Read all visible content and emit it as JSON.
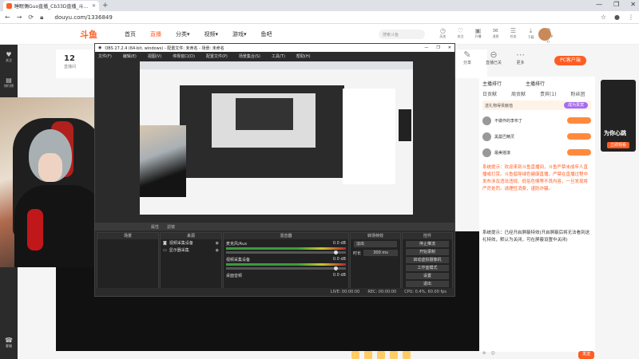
{
  "browser": {
    "tab_title": "睡眠偶Guo直播_Cb33D直播_斗...",
    "url": "douyu.com/1336849",
    "window_controls": [
      "—",
      "❐",
      "✕"
    ]
  },
  "header": {
    "logo": "斗鱼",
    "nav": [
      "首页",
      "直播",
      "分类▾",
      "视频▾",
      "游戏▾",
      "鱼吧"
    ],
    "active_nav": "直播",
    "search_placeholder": "搜索斗鱼",
    "icons": [
      {
        "label": "历史",
        "icon": "history-icon"
      },
      {
        "label": "关注",
        "icon": "follow-icon"
      },
      {
        "label": "开播",
        "icon": "live-icon"
      },
      {
        "label": "消息",
        "icon": "message-icon"
      },
      {
        "label": "任务",
        "icon": "task-icon"
      },
      {
        "label": "下载",
        "icon": "download-icon"
      },
      {
        "label": "会员中心",
        "icon": "vip-icon"
      }
    ]
  },
  "sidebar": {
    "items": [
      {
        "label": "关注",
        "icon": "heart-icon"
      },
      {
        "label": "排行榜",
        "icon": "rank-icon"
      },
      {
        "label": "客服",
        "icon": "service-icon"
      }
    ]
  },
  "room": {
    "number": "12",
    "subtext": "直播间",
    "pc_button": "PC客户端",
    "side_buttons": [
      {
        "label": "分享",
        "icon": "share-icon"
      },
      {
        "label": "直播已关",
        "icon": "closed-icon"
      },
      {
        "label": "更多",
        "icon": "more-icon"
      }
    ]
  },
  "rank": {
    "header_left": "主播排行",
    "header_right": "主播排行",
    "tabs": [
      "日贡献",
      "周贡献",
      "贵宾(1)",
      "粉丝团"
    ],
    "bar_text": "送礼物得贡献值",
    "bar_button": "成为贵宾",
    "rows": [
      {
        "name": "不做作的李布丁"
      },
      {
        "name": "黑曼巴精灵"
      },
      {
        "name": "最美摇滚"
      }
    ]
  },
  "chat": {
    "system": "系统提示：欢迎来到斗鱼直播间，斗鱼严禁未成年人直播或打赏。斗鱼倡导绿色健康直播，严禁在直播过程中发布涉及违法违规、低俗色情等不良内容，一旦发现将严厉处罚。请理性消费，谨防诈骗。",
    "notice": "系统提示：已经开启屏蔽特效(开启屏蔽后将无法看到送礼特效，默认为关闭，可在屏蔽设置中关闭)",
    "send_label": "发送"
  },
  "ad": {
    "text": "为你心跳",
    "button": "立即观看"
  },
  "obs": {
    "title": "OBS 27.2.4 (64-bit, windows) - 配置文件: 未命名 - 场景: 未命名",
    "menu": [
      "文件(F)",
      "编辑(E)",
      "视图(V)",
      "停靠窗口(D)",
      "配置文件(P)",
      "场景集合(S)",
      "工具(T)",
      "帮助(H)"
    ],
    "toolbar": [
      "属性",
      "滤镜"
    ],
    "docks": {
      "scenes": "场景",
      "sources": "来源",
      "mixer": "混音器",
      "transitions": "转场特效",
      "controls": "控件"
    },
    "sources": [
      {
        "name": "视频采集设备",
        "icon": "camera-icon"
      },
      {
        "name": "显示器采集",
        "icon": "monitor-icon"
      }
    ],
    "mixer": [
      {
        "name": "麦克风/Aux",
        "db": "0.0 dB"
      },
      {
        "name": "视频采集设备",
        "db": "0.0 dB"
      },
      {
        "name": "桌面音频",
        "db": "0.0 dB"
      }
    ],
    "transition": {
      "type": "淡出",
      "duration_label": "时长",
      "duration": "300 ms"
    },
    "controls": [
      "停止推流",
      "开始录制",
      "启动虚拟摄像机",
      "工作室模式",
      "设置",
      "退出"
    ],
    "status": [
      "LIVE: 00:00:00",
      "REC: 00:00:00",
      "CPU: 0.4%, 60.00 fps"
    ]
  }
}
